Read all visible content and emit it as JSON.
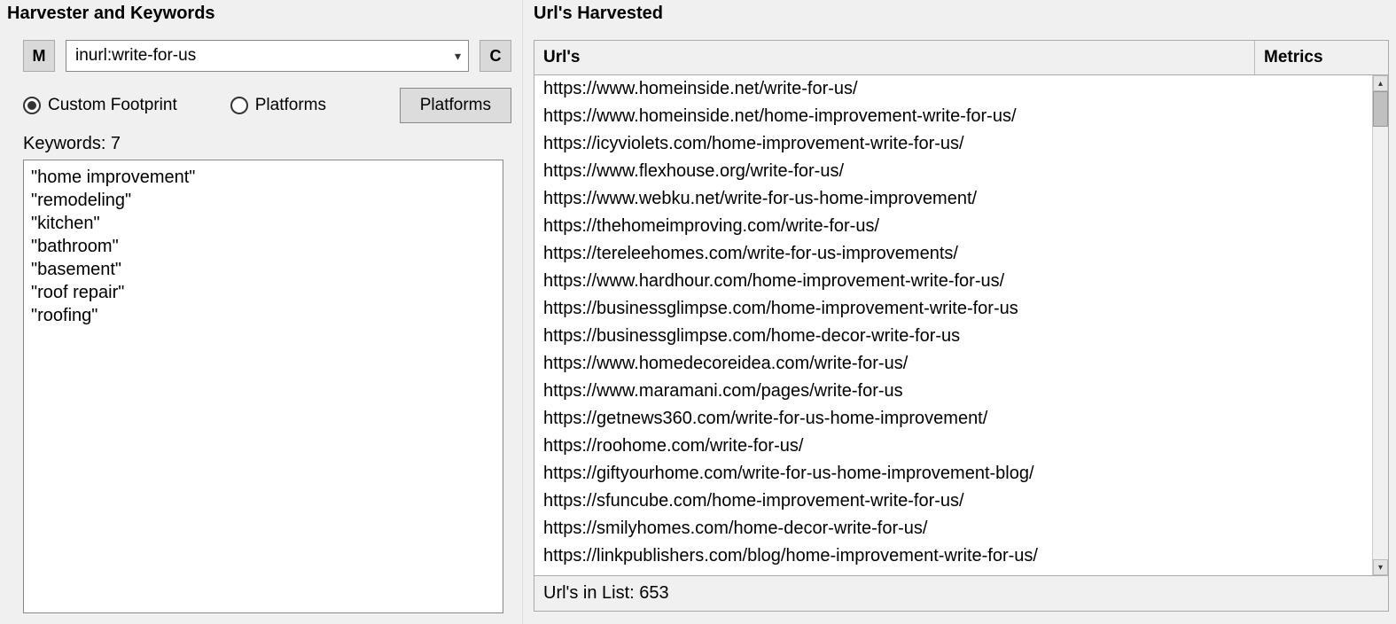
{
  "left": {
    "title": "Harvester and Keywords",
    "m_button": "M",
    "footprint_value": "inurl:write-for-us",
    "c_button": "C",
    "radio_custom": "Custom Footprint",
    "radio_platforms": "Platforms",
    "platforms_button": "Platforms",
    "keywords_label": "Keywords:  7",
    "keywords_text": "\"home improvement\"\n\"remodeling\"\n\"kitchen\"\n\"bathroom\"\n\"basement\"\n\"roof repair\"\n\"roofing\""
  },
  "right": {
    "title": "Url's Harvested",
    "col_urls": "Url's",
    "col_metrics": "Metrics",
    "urls": [
      "https://www.homeinside.net/write-for-us/",
      "https://www.homeinside.net/home-improvement-write-for-us/",
      "https://icyviolets.com/home-improvement-write-for-us/",
      "https://www.flexhouse.org/write-for-us/",
      "https://www.webku.net/write-for-us-home-improvement/",
      "https://thehomeimproving.com/write-for-us/",
      "https://tereleehomes.com/write-for-us-improvements/",
      "https://www.hardhour.com/home-improvement-write-for-us/",
      "https://businessglimpse.com/home-improvement-write-for-us",
      "https://businessglimpse.com/home-decor-write-for-us",
      "https://www.homedecoreidea.com/write-for-us/",
      "https://www.maramani.com/pages/write-for-us",
      "https://getnews360.com/write-for-us-home-improvement/",
      "https://roohome.com/write-for-us/",
      "https://giftyourhome.com/write-for-us-home-improvement-blog/",
      "https://sfuncube.com/home-improvement-write-for-us/",
      "https://smilyhomes.com/home-decor-write-for-us/",
      "https://linkpublishers.com/blog/home-improvement-write-for-us/"
    ],
    "footer": "Url's in List:  653"
  }
}
